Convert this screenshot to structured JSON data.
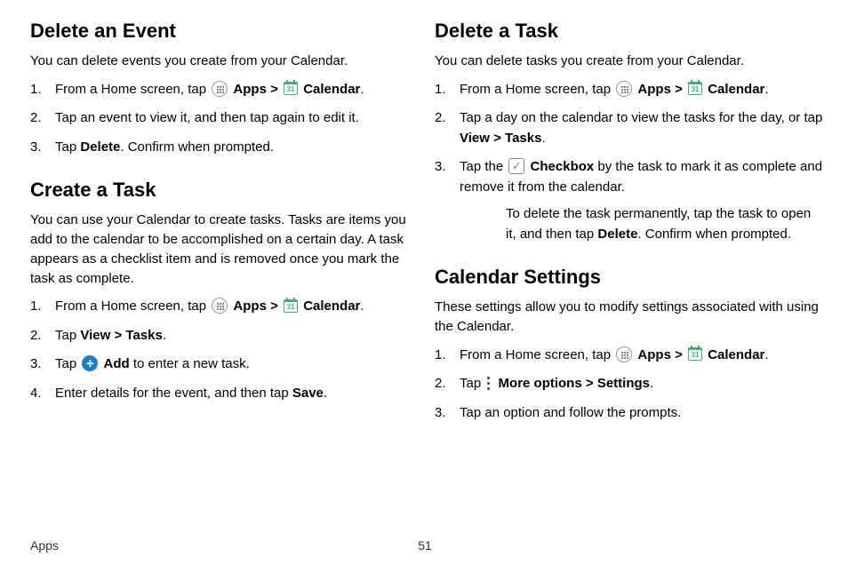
{
  "footer": {
    "section": "Apps",
    "page": "51"
  },
  "left": {
    "sec1": {
      "title": "Delete an Event",
      "intro": "You can delete events you create from your Calendar.",
      "li1a": "From a Home screen, tap ",
      "apps": "Apps",
      "chev": " > ",
      "cal": "Calendar",
      "dot": ".",
      "li2": "Tap an event to view it, and then tap again to edit it.",
      "li3a": "Tap ",
      "li3b": "Delete",
      "li3c": ". Confirm when prompted."
    },
    "sec2": {
      "title": "Create a Task",
      "intro": "You can use your Calendar to create tasks. Tasks are items you add to the calendar to be accomplished on a certain day. A task appears as a checklist item and is removed once you mark the task as complete.",
      "li1a": "From a Home screen, tap ",
      "apps": "Apps",
      "chev": " > ",
      "cal": "Calendar",
      "dot": ".",
      "li2a": "Tap ",
      "li2b": "View",
      "li2c": " > ",
      "li2d": "Tasks",
      "li2e": ".",
      "li3a": "Tap ",
      "li3b": "Add",
      "li3c": " to enter a new task.",
      "li4a": "Enter details for the event, and then tap ",
      "li4b": "Save",
      "li4c": "."
    }
  },
  "right": {
    "sec1": {
      "title": "Delete a Task",
      "intro": "You can delete tasks you create from your Calendar.",
      "li1a": "From a Home screen, tap ",
      "apps": "Apps",
      "chev": " > ",
      "cal": "Calendar",
      "dot": ".",
      "li2a": "Tap a day on the calendar to view the tasks for the day, or tap ",
      "li2b": "View",
      "li2c": " > ",
      "li2d": "Tasks",
      "li2e": ".",
      "li3a": "Tap the ",
      "li3b": "Checkbox",
      "li3c": " by the task to mark it as complete and remove it from the calendar.",
      "suba": "To delete the task permanently, tap the task to open it, and then tap ",
      "subb": "Delete",
      "subc": ". Confirm when prompted."
    },
    "sec2": {
      "title": "Calendar Settings",
      "intro": "These settings allow you to modify settings associated with using the Calendar.",
      "li1a": "From a Home screen, tap ",
      "apps": "Apps",
      "chev": " > ",
      "cal": "Calendar",
      "dot": ".",
      "li2a": "Tap ",
      "li2b": "More options",
      "li2c": " > ",
      "li2d": "Settings",
      "li2e": ".",
      "li3": "Tap an option and follow the prompts."
    }
  },
  "iconText": {
    "calDay": "31",
    "add": "+",
    "check": "✓"
  }
}
